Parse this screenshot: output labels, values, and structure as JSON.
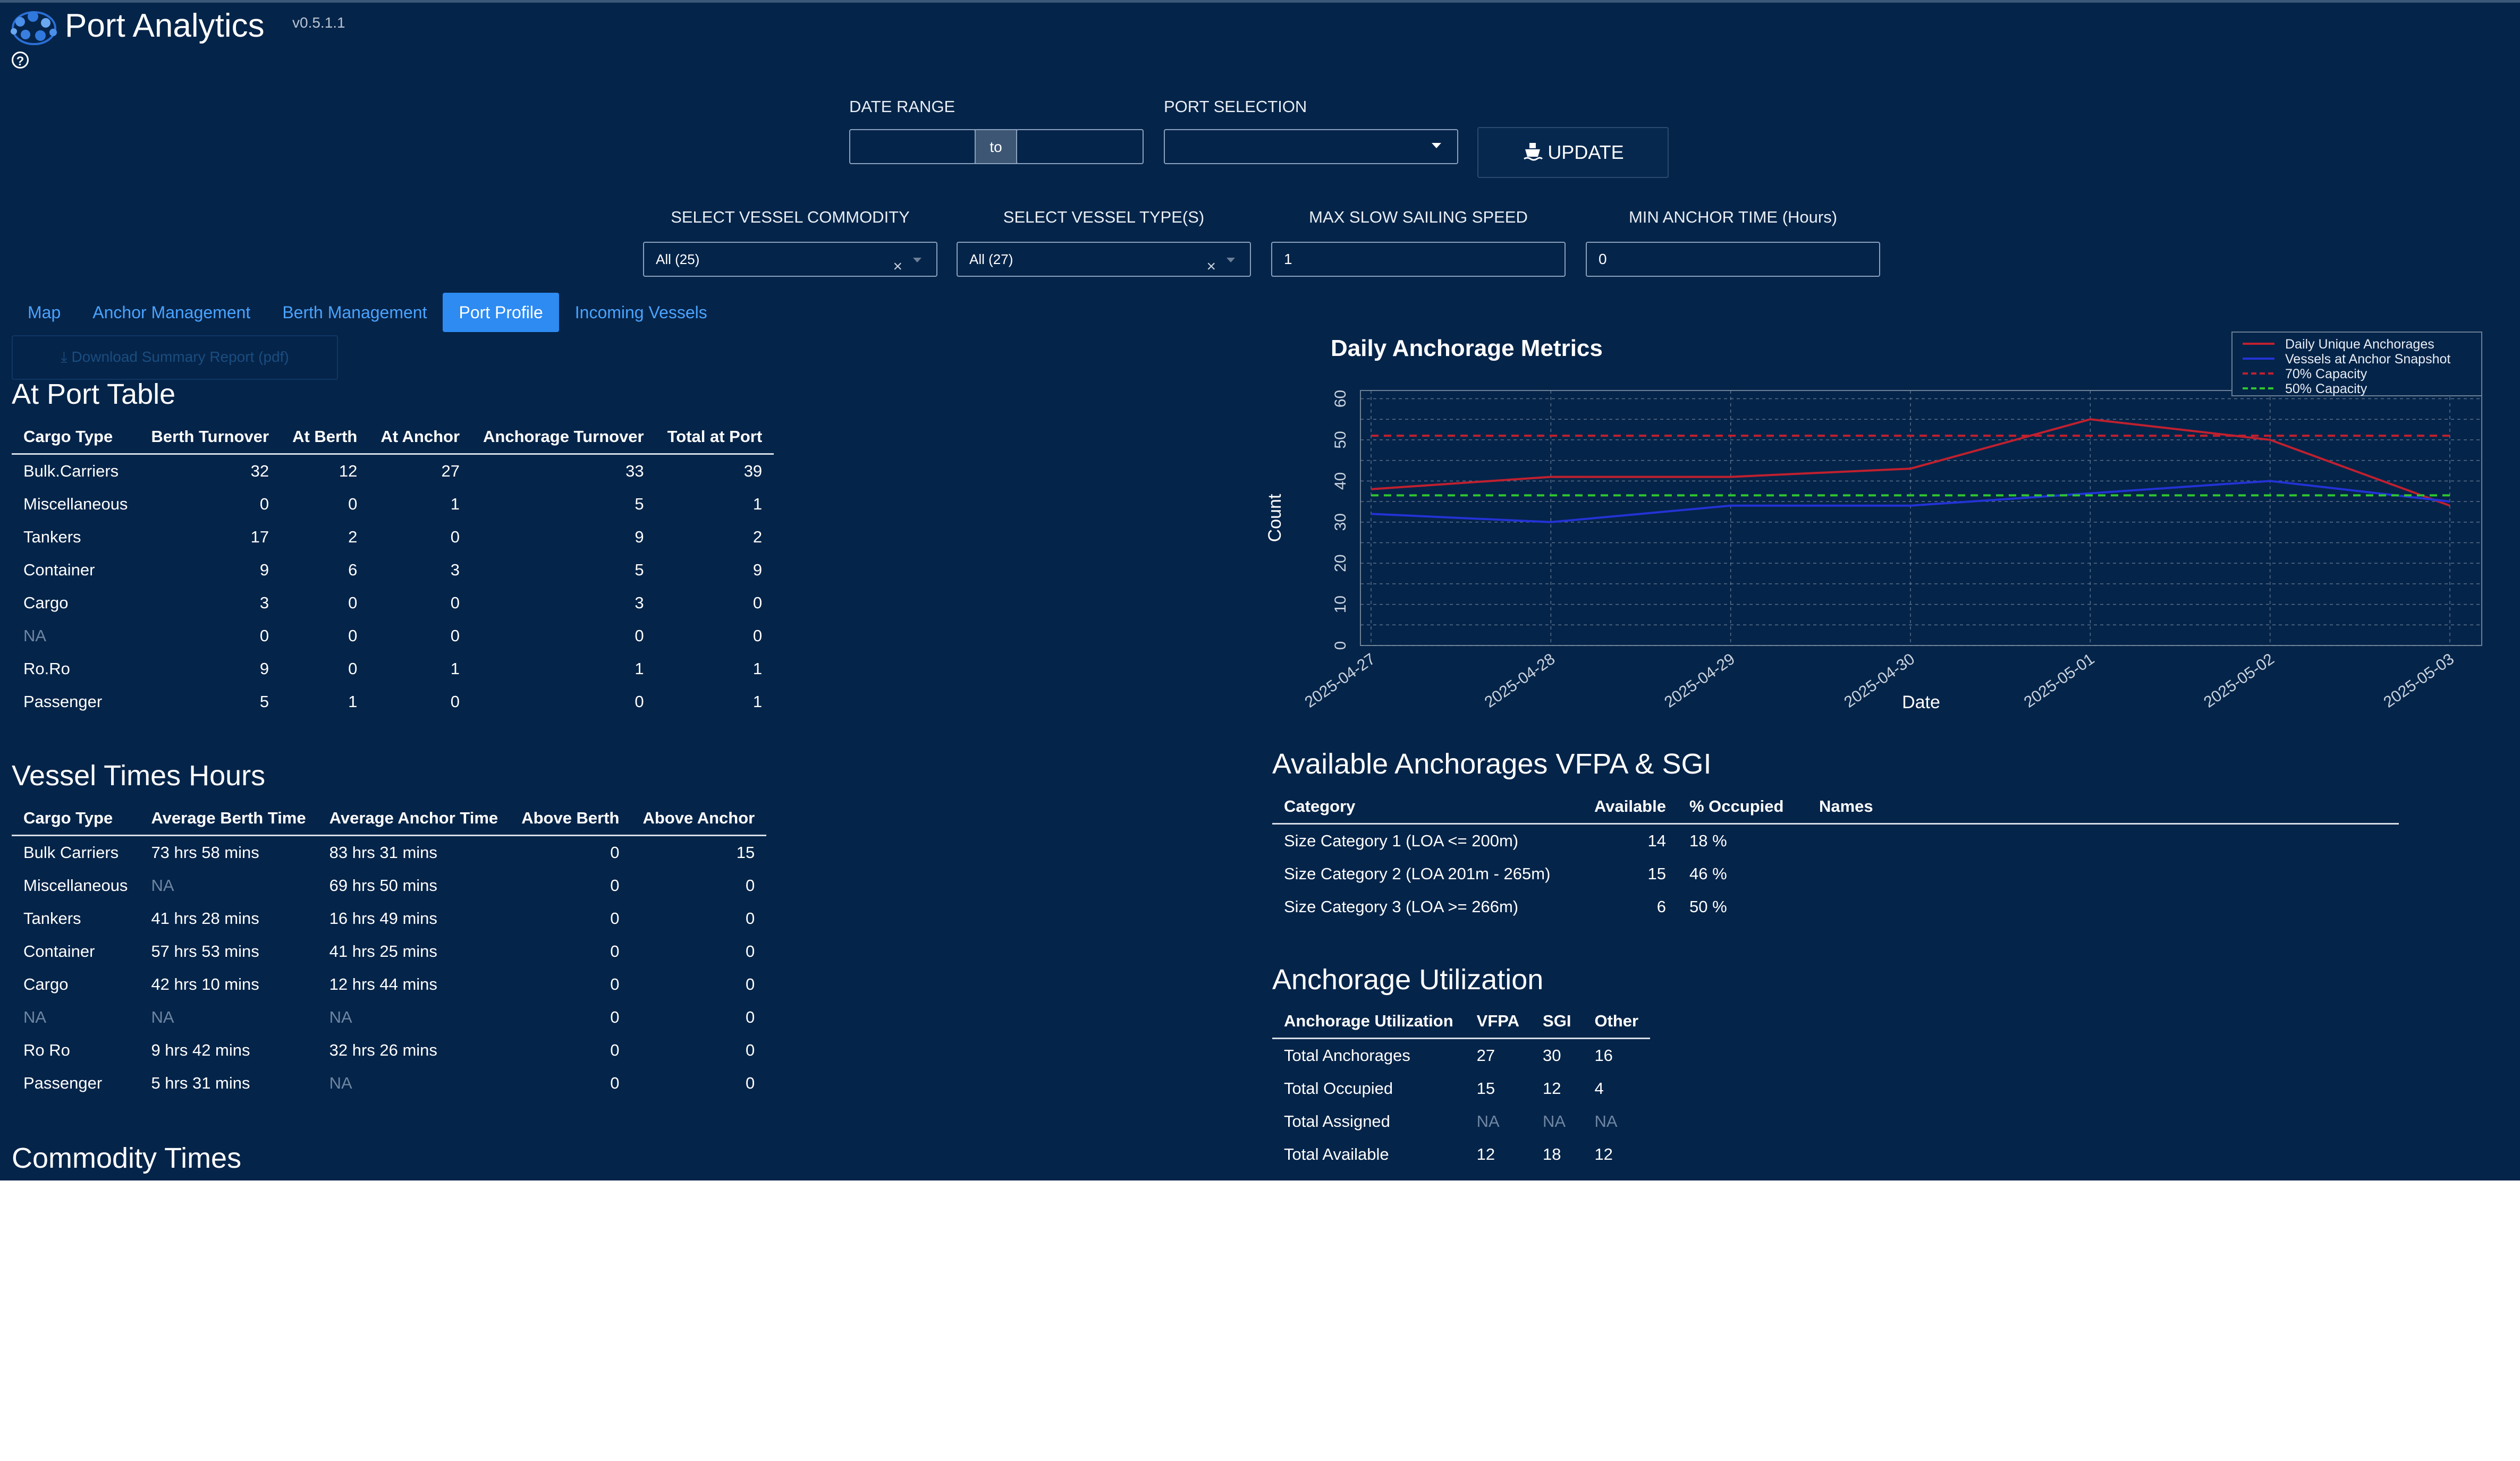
{
  "app": {
    "title": "Port Analytics",
    "version": "v0.5.1.1",
    "help_glyph": "?",
    "logo_icon": "globe-network-icon"
  },
  "filters": {
    "date_range_label": "DATE RANGE",
    "date_to": "to",
    "date_start": "",
    "date_end": "",
    "port_selection_label": "PORT SELECTION",
    "port_selection_value": "",
    "update_label": "UPDATE",
    "update_icon": "ship-icon",
    "commodity_label": "SELECT VESSEL COMMODITY",
    "commodity_value": "All (25)",
    "vessel_type_label": "SELECT VESSEL TYPE(S)",
    "vessel_type_value": "All (27)",
    "clear_glyph": "×",
    "max_speed_label": "MAX SLOW SAILING SPEED",
    "max_speed_value": "1",
    "min_anchor_label": "MIN ANCHOR TIME (Hours)",
    "min_anchor_value": "0"
  },
  "tabs": [
    {
      "label": "Map",
      "active": false
    },
    {
      "label": "Anchor Management",
      "active": false
    },
    {
      "label": "Berth Management",
      "active": false
    },
    {
      "label": "Port Profile",
      "active": true
    },
    {
      "label": "Incoming Vessels",
      "active": false
    }
  ],
  "download_label": "Download Summary Report (pdf)",
  "at_port": {
    "title": "At Port Table",
    "headers": [
      "Cargo Type",
      "Berth Turnover",
      "At Berth",
      "At Anchor",
      "Anchorage Turnover",
      "Total at Port"
    ],
    "rows": [
      [
        "Bulk.Carriers",
        "32",
        "12",
        "27",
        "33",
        "39"
      ],
      [
        "Miscellaneous",
        "0",
        "0",
        "1",
        "5",
        "1"
      ],
      [
        "Tankers",
        "17",
        "2",
        "0",
        "9",
        "2"
      ],
      [
        "Container",
        "9",
        "6",
        "3",
        "5",
        "9"
      ],
      [
        "Cargo",
        "3",
        "0",
        "0",
        "3",
        "0"
      ],
      [
        "NA",
        "0",
        "0",
        "0",
        "0",
        "0"
      ],
      [
        "Ro.Ro",
        "9",
        "0",
        "1",
        "1",
        "1"
      ],
      [
        "Passenger",
        "5",
        "1",
        "0",
        "0",
        "1"
      ]
    ]
  },
  "vessel_times": {
    "title": "Vessel Times Hours",
    "headers": [
      "Cargo Type",
      "Average Berth Time",
      "Average Anchor Time",
      "Above Berth",
      "Above Anchor"
    ],
    "rows": [
      [
        "Bulk Carriers",
        "73 hrs 58 mins",
        "83 hrs 31 mins",
        "0",
        "15"
      ],
      [
        "Miscellaneous",
        "NA",
        "69 hrs 50 mins",
        "0",
        "0"
      ],
      [
        "Tankers",
        "41 hrs 28 mins",
        "16 hrs 49 mins",
        "0",
        "0"
      ],
      [
        "Container",
        "57 hrs 53 mins",
        "41 hrs 25 mins",
        "0",
        "0"
      ],
      [
        "Cargo",
        "42 hrs 10 mins",
        "12 hrs 44 mins",
        "0",
        "0"
      ],
      [
        "NA",
        "NA",
        "NA",
        "0",
        "0"
      ],
      [
        "Ro Ro",
        "9 hrs 42 mins",
        "32 hrs 26 mins",
        "0",
        "0"
      ],
      [
        "Passenger",
        "5 hrs 31 mins",
        "NA",
        "0",
        "0"
      ]
    ]
  },
  "commodity_times": {
    "title": "Commodity Times"
  },
  "available_anchorages": {
    "title": "Available Anchorages VFPA & SGI",
    "headers": [
      "Category",
      "Available",
      "% Occupied",
      "Names"
    ],
    "rows": [
      [
        "Size Category 1 (LOA <= 200m)",
        "14",
        "18 %",
        ""
      ],
      [
        "Size Category 2 (LOA 201m - 265m)",
        "15",
        "46 %",
        ""
      ],
      [
        "Size Category 3 (LOA >= 266m)",
        "6",
        "50 %",
        ""
      ]
    ]
  },
  "anchorage_utilization": {
    "title": "Anchorage Utilization",
    "headers": [
      "Anchorage Utilization",
      "VFPA",
      "SGI",
      "Other"
    ],
    "rows": [
      [
        "Total Anchorages",
        "27",
        "30",
        "16"
      ],
      [
        "Total Occupied",
        "15",
        "12",
        "4"
      ],
      [
        "Total Assigned",
        "NA",
        "NA",
        "NA"
      ],
      [
        "Total Available",
        "12",
        "18",
        "12"
      ]
    ]
  },
  "chart_data": {
    "type": "line",
    "title": "Daily Anchorage Metrics",
    "xlabel": "Date",
    "ylabel": "Count",
    "x": [
      "2025-04-27",
      "2025-04-28",
      "2025-04-29",
      "2025-04-30",
      "2025-05-01",
      "2025-05-02",
      "2025-05-03"
    ],
    "ylim": [
      0,
      62
    ],
    "yticks": [
      0,
      10,
      20,
      30,
      40,
      50,
      60
    ],
    "grid": true,
    "legend_position": "top-right",
    "series": [
      {
        "name": "Daily Unique Anchorages",
        "values": [
          38,
          41,
          41,
          43,
          55,
          50,
          34
        ],
        "color": "#c0202f",
        "dash": "solid"
      },
      {
        "name": "Vessels at Anchor Snapshot",
        "values": [
          32,
          30,
          34,
          34,
          37,
          40,
          35
        ],
        "color": "#2333d6",
        "dash": "solid"
      },
      {
        "name": "70% Capacity",
        "values": [
          51,
          51,
          51,
          51,
          51,
          51,
          51
        ],
        "color": "#c0202f",
        "dash": "dashed"
      },
      {
        "name": "50% Capacity",
        "values": [
          36.5,
          36.5,
          36.5,
          36.5,
          36.5,
          36.5,
          36.5
        ],
        "color": "#2fc62f",
        "dash": "dashed"
      }
    ]
  }
}
